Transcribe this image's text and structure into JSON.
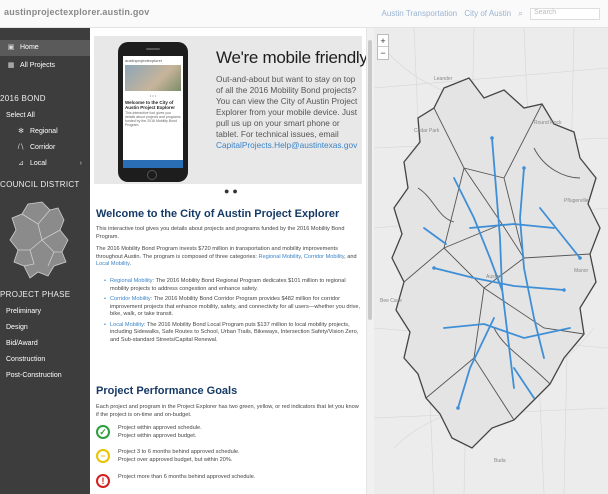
{
  "header": {
    "site": "austinprojectexplorer.austin.gov",
    "links": [
      "Austin Transportation",
      "City of Austin"
    ],
    "search_placeholder": "Search"
  },
  "sidebar": {
    "home": "Home",
    "all_projects": "All Projects",
    "bond_heading": "2016 BOND",
    "select_all": "Select All",
    "regional": "Regional",
    "corridor": "Corridor",
    "local": "Local",
    "council_heading": "COUNCIL DISTRICT",
    "phase_heading": "PROJECT PHASE",
    "phases": [
      "Preliminary",
      "Design",
      "Bid/Award",
      "Construction",
      "Post-Construction"
    ]
  },
  "banner": {
    "title": "We're mobile friendly!",
    "body": "Out-and-about but want to stay on top of all the 2016 Mobility Bond projects? You can view the City of Austin Project Explorer from your mobile device. Just pull us up on your smart phone or tablet. For technical issues, email",
    "email": "CapitalProjects.Help@austintexas.gov",
    "phone_brand": "austinprojectexplorer",
    "phone_title": "Welcome to the City of Austin Project Explorer",
    "phone_text": "This interactive tool gives you details about projects and programs funded by the 2016 Mobility Bond Program."
  },
  "welcome": {
    "title": "Welcome to the City of Austin Project Explorer",
    "intro": "This interactive tool gives you details about projects and programs funded by the 2016 Mobility Bond Program.",
    "program_a": "The 2016 Mobility Bond Program invests $720 million in transportation and mobility improvements throughout Austin. The program is composed of three categories:",
    "link_regional": "Regional Mobility",
    "link_corridor": "Corridor Mobility",
    "link_and": ", and",
    "link_local": "Local Mobility",
    "bullets": [
      {
        "label": "Regional Mobility:",
        "text": "The 2016 Mobility Bond Regional Program dedicates $101 million to regional mobility projects to address congestion and enhance safety."
      },
      {
        "label": "Corridor Mobility:",
        "text": "The 2016 Mobility Bond Corridor Program provides $482 million for corridor improvement projects that enhance mobility, safety, and connectivity for all users—whether you drive, bike, walk, or take transit."
      },
      {
        "label": "Local Mobility:",
        "text": "The 2016 Mobility Bond Local Program puts $137 million to local mobility projects, including Sidewalks, Safe Routes to School, Urban Trails, Bikeways, Intersection Safety/Vision Zero, and Sub-standard Streets/Capital Renewal."
      }
    ]
  },
  "goals": {
    "title": "Project Performance Goals",
    "desc": "Each project and program in the Project Explorer has two green, yellow, or red indicators that let you know if the project is on-time and on-budget.",
    "items": [
      {
        "line1": "Project within approved schedule.",
        "line2": "Project within approved budget.",
        "color": "#2e9e3f",
        "icon": "check-icon",
        "glyph": "✓"
      },
      {
        "line1": "Project 3 to 6 months behind approved schedule.",
        "line2": "Project over approved budget, but within 20%.",
        "color": "#e8c400",
        "icon": "warning-icon",
        "glyph": "−"
      },
      {
        "line1": "Project more than 6 months behind approved schedule.",
        "line2": "",
        "color": "#d42020",
        "icon": "alert-icon",
        "glyph": "!"
      }
    ]
  },
  "map": {
    "zoom_in": "+",
    "zoom_out": "−",
    "labels": [
      "Leander",
      "Cedar Park",
      "Round Rock",
      "Pflugerville",
      "Manor",
      "Austin",
      "Bee Cave",
      "Buda"
    ]
  },
  "colors": {
    "sidebar": "#3d3d3d",
    "heading": "#163a66",
    "link": "#3a84c8",
    "route": "#3f8fd6"
  }
}
